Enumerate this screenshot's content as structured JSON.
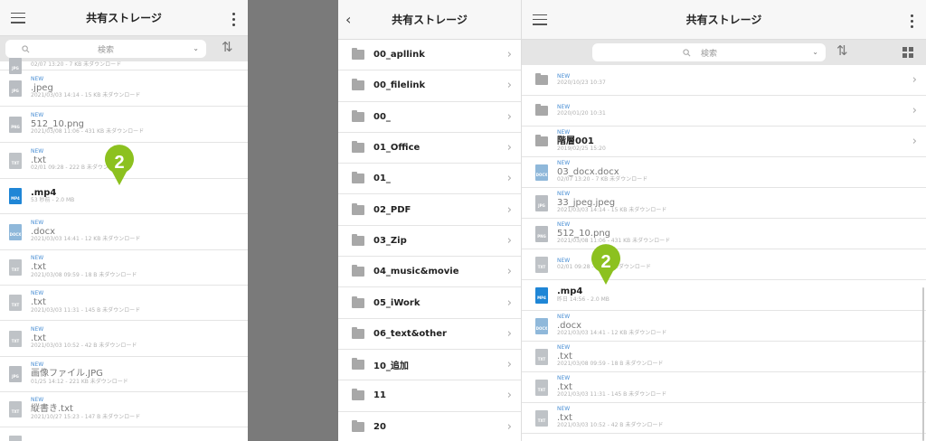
{
  "phone": {
    "title": "共有ストレージ",
    "search_placeholder": "検索",
    "files": [
      {
        "icon": "jpg",
        "new": "",
        "name": "",
        "sub": "02/07 13:20 - 7 KB 未ダウンロード",
        "partial": true
      },
      {
        "icon": "jpg",
        "new": "NEW",
        "name": ".jpeg",
        "sub": "2021/03/03 14:14 - 15 KB 未ダウンロード"
      },
      {
        "icon": "png",
        "new": "NEW",
        "name": "512_10.png",
        "sub": "2021/03/08 11:06 - 431 KB 未ダウンロード"
      },
      {
        "icon": "txt",
        "new": "NEW",
        "name": ".txt",
        "sub": "02/01 09:28 - 222 B 未ダウンロード"
      },
      {
        "icon": "mp4",
        "new": "",
        "name": ".mp4",
        "sub": "53 秒前 - 2.0 MB",
        "bold": true
      },
      {
        "icon": "docx",
        "new": "NEW",
        "name": ".docx",
        "sub": "2021/03/03 14:41 - 12 KB 未ダウンロード"
      },
      {
        "icon": "txt",
        "new": "NEW",
        "name": ".txt",
        "sub": "2021/03/08 09:59 - 18 B 未ダウンロード"
      },
      {
        "icon": "txt",
        "new": "NEW",
        "name": ".txt",
        "sub": "2021/03/03 11:31 - 145 B 未ダウンロード"
      },
      {
        "icon": "txt",
        "new": "NEW",
        "name": ".txt",
        "sub": "2021/03/03 10:52 - 42 B 未ダウンロード"
      },
      {
        "icon": "jpg",
        "new": "NEW",
        "name": "画像ファイル.JPG",
        "sub": "01/25 14:12 - 221 KB 未ダウンロード"
      },
      {
        "icon": "txt",
        "new": "NEW",
        "name": "縦書き.txt",
        "sub": "2021/10/27 15:23 - 147 B 未ダウンロード"
      },
      {
        "icon": "txt",
        "new": "",
        "name": "",
        "sub": "",
        "partial": true
      }
    ],
    "badge": "2"
  },
  "tablet": {
    "left_title": "共有ストレージ",
    "folders": [
      "00_apllink",
      "00_filelink",
      "00_",
      "01_Office",
      "01_",
      "02_PDF",
      "03_Zip",
      "04_music&movie",
      "05_iWork",
      "06_text&other",
      "10_追加",
      "11",
      "20"
    ],
    "right_title": "共有ストレージ",
    "search_placeholder": "検索",
    "files": [
      {
        "type": "folder",
        "new": "NEW",
        "name": "",
        "sub": "2020/10/23 10:37"
      },
      {
        "type": "folder",
        "new": "NEW",
        "name": "",
        "sub": "2020/01/20 10:31"
      },
      {
        "type": "folder",
        "new": "NEW",
        "name": "階層001",
        "sub": "2019/02/25 15:20",
        "bold": true
      },
      {
        "type": "docx",
        "new": "NEW",
        "name": "03_docx.docx",
        "sub": "02/07 13:20 - 7 KB 未ダウンロード"
      },
      {
        "type": "jpg",
        "new": "NEW",
        "name": "33_jpeg.jpeg",
        "sub": "2021/03/03 14:14 - 15 KB 未ダウンロード"
      },
      {
        "type": "png",
        "new": "NEW",
        "name": "512_10.png",
        "sub": "2021/03/08 11:06 - 431 KB 未ダウンロード"
      },
      {
        "type": "txt",
        "new": "NEW",
        "name": "",
        "sub": "02/01 09:28 - 222 B 未ダウンロード"
      },
      {
        "type": "mp4",
        "new": "",
        "name": ".mp4",
        "sub": "昨日 14:56 - 2.0 MB",
        "bold": true
      },
      {
        "type": "docx",
        "new": "NEW",
        "name": ".docx",
        "sub": "2021/03/03 14:41 - 12 KB 未ダウンロード"
      },
      {
        "type": "txt",
        "new": "NEW",
        "name": ".txt",
        "sub": "2021/03/08 09:59 - 18 B 未ダウンロード"
      },
      {
        "type": "txt",
        "new": "NEW",
        "name": ".txt",
        "sub": "2021/03/03 11:31 - 145 B 未ダウンロード"
      },
      {
        "type": "txt",
        "new": "NEW",
        "name": ".txt",
        "sub": "2021/03/03 10:52 - 42 B 未ダウンロード"
      }
    ],
    "badge": "2"
  },
  "colors": {
    "badge": "#8cc11f",
    "new": "#4a8fd4",
    "mp4": "#1f86d6"
  }
}
